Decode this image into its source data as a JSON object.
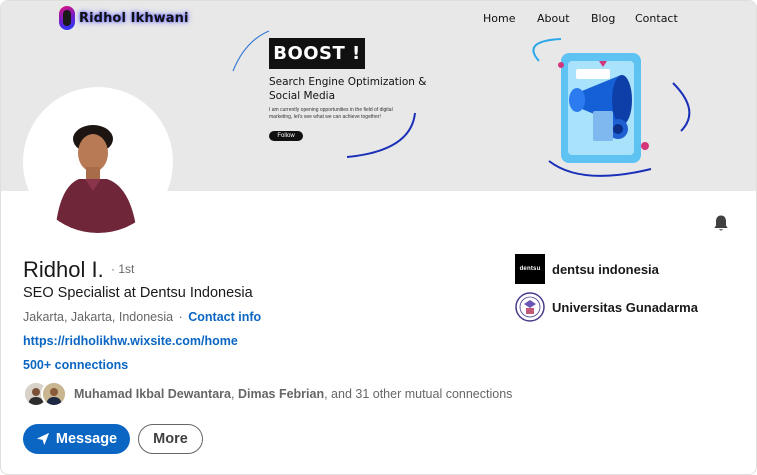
{
  "banner": {
    "brand": "Ridhol Ikhwani",
    "nav": [
      "Home",
      "About",
      "Blog",
      "Contact"
    ],
    "boost_title": "BOOST !",
    "tagline_line1": "Search Engine Optimization  &",
    "tagline_line2": "Social Media",
    "small_copy": "I am currently opening opportunities in the field of digital marketing, let's see what we can achieve together!",
    "follow_label": "Follow"
  },
  "profile": {
    "name": "Ridhol I.",
    "degree": "· 1st",
    "headline": "SEO Specialist at Dentsu Indonesia",
    "location": "Jakarta, Jakarta, Indonesia",
    "separator": "·",
    "contact_info": "Contact info",
    "website": "https://ridholikhw.wixsite.com/home",
    "connections": "500+ connections",
    "mutual": {
      "name1": "Muhamad Ikbal Dewantara",
      "sep": ", ",
      "name2": "Dimas Febrian",
      "rest": ", and 31 other mutual connections"
    }
  },
  "actions": {
    "message": "Message",
    "more": "More"
  },
  "orgs": [
    {
      "name": "dentsu indonesia",
      "logo_text": "dentsu"
    },
    {
      "name": "Universitas Gunadarma"
    }
  ],
  "colors": {
    "accent": "#0a66c2",
    "banner_bg": "#e8e8e8",
    "text_muted": "#666666"
  }
}
